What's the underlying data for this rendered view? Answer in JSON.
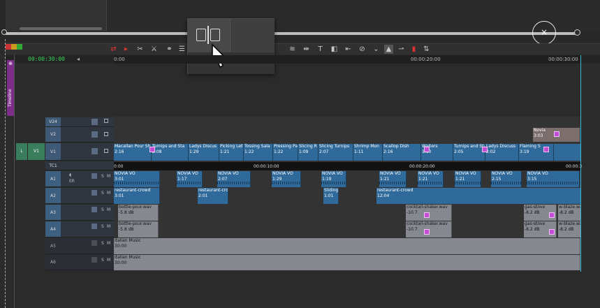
{
  "overlay": {
    "close_symbol": "×"
  },
  "timecode": "00:00:30:00",
  "ruler": {
    "labels": [
      "0:00",
      "00:00:20:00",
      "00:00:30:00"
    ]
  },
  "tab": {
    "label": "Timeline"
  },
  "tc1_ruler": {
    "labels": [
      "0:00",
      "00:00:10:00",
      "00:00:20:00",
      "00:00:3"
    ]
  },
  "tracks": {
    "v24": "V24",
    "v2": "V2",
    "v1": "V1",
    "tc1": "TC1",
    "a1": "A1",
    "a2": "A2",
    "a3": "A3",
    "a4": "A4",
    "a5": "A5",
    "a6": "A6",
    "v1_patch_left": "L",
    "v1_patch_right": "V1",
    "a1_state": "ER"
  },
  "v2_clips": [
    {
      "name": "Novia",
      "dur": "3:03"
    }
  ],
  "v1_clips": [
    {
      "name": "Macallan Pour Sh",
      "dur": "2:16"
    },
    {
      "name": "Turnips and Sta",
      "dur": "2:08"
    },
    {
      "name": "Ladys Discus",
      "dur": "1:29"
    },
    {
      "name": "Picking Lett",
      "dur": "1:21"
    },
    {
      "name": "Tossing Sala",
      "dur": "1:22"
    },
    {
      "name": "Pressing Pa",
      "dur": "1:22"
    },
    {
      "name": "Slicing R",
      "dur": "1:09"
    },
    {
      "name": "Slicing Turnips",
      "dur": "2:07"
    },
    {
      "name": "Shrimp Mon",
      "dur": "1:11"
    },
    {
      "name": "Scallop Dish",
      "dur": "2:16"
    },
    {
      "name": "Waiters",
      "dur": "1:10"
    },
    {
      "name": "Turnips and Sta",
      "dur": "2:05"
    },
    {
      "name": "Ladys Discuss",
      "dur": "2:02"
    },
    {
      "name": "Flaming S",
      "dur": "3:19"
    }
  ],
  "a1_clips": [
    {
      "name": "NOVIA VO",
      "dur": "3:01"
    },
    {
      "name": "NOVIA VO",
      "dur": "1:17"
    },
    {
      "name": "NOVIA VO",
      "dur": "2:07"
    },
    {
      "name": "NOVIA VO",
      "dur": "1:29"
    },
    {
      "name": "NOVIA VO",
      "dur": "1:19"
    },
    {
      "name": "NOVIA VO",
      "dur": "1:21"
    },
    {
      "name": "NOVIA VO",
      "dur": "1:21"
    },
    {
      "name": "NOVIA VO",
      "dur": "1:21"
    },
    {
      "name": "NOVIA VO",
      "dur": "2:15"
    },
    {
      "name": "NOVIA VO",
      "dur": "3:15"
    }
  ],
  "a2_clips": [
    {
      "name": "restaurant-crowd",
      "dur": "3:01"
    },
    {
      "name": "restaurant-cro",
      "dur": "2:01"
    },
    {
      "name": "Sliding",
      "dur": "1:01"
    },
    {
      "name": "restaurant-crowd",
      "dur": "12:04"
    }
  ],
  "a3_clips": [
    {
      "name": "bottle-pour.wav",
      "dur": "-5.8 dB"
    },
    {
      "name": "cocktail-shaker.wav",
      "dur": "-10.7"
    },
    {
      "name": "gas-stove",
      "dur": "-8.2 dB"
    },
    {
      "name": "w-blaze.wav",
      "dur": "-8.2 dB"
    }
  ],
  "a4_clips": [
    {
      "name": "bottle-pour.wav",
      "dur": "-5.8 dB"
    },
    {
      "name": "cocktail-shaker.wav",
      "dur": "-10.7"
    },
    {
      "name": "gas-stove",
      "dur": "-8.2 dB"
    },
    {
      "name": "w-blaze.wav",
      "dur": "-8.2 dB"
    }
  ],
  "a5_clip": {
    "name": "Italian Music",
    "dur": "30:00"
  },
  "a6_clip": {
    "name": "Italian Music",
    "dur": "30:00"
  },
  "colors": {
    "clip_blue": "#2f6a9b",
    "clip_grey": "#85898f",
    "effect_pink": "#c44bd6",
    "timecode_green": "#39d353",
    "playhead_cyan": "#3ab6d6",
    "tab_purple": "#7b2e8a"
  }
}
